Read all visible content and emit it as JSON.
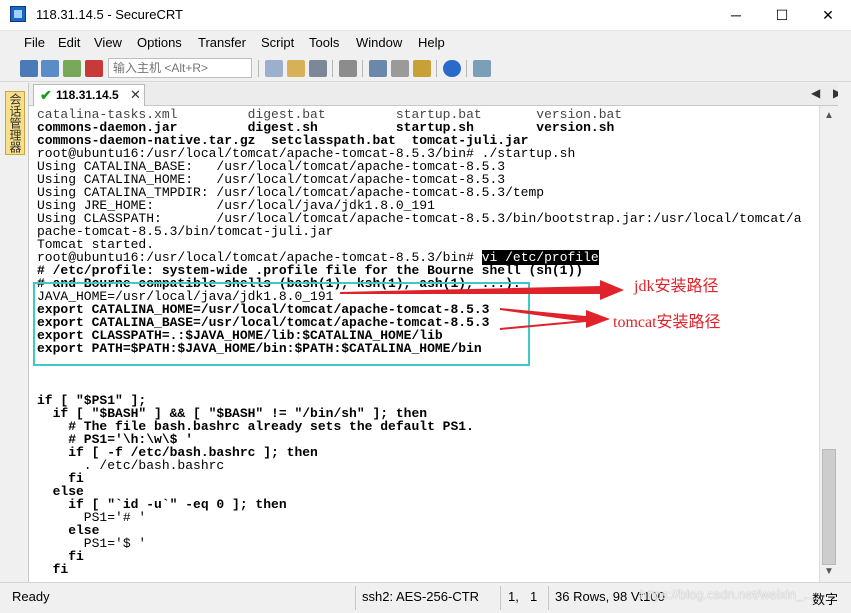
{
  "window": {
    "title": "118.31.14.5 - SecureCRT",
    "minimize": "─",
    "maximize": "☐",
    "close": "✕"
  },
  "menu": [
    "File",
    "Edit",
    "View",
    "Options",
    "Transfer",
    "Script",
    "Tools",
    "Window",
    "Help"
  ],
  "toolbar": {
    "host_placeholder": "输入主机 <Alt+R>"
  },
  "side_panel": {
    "label": "会话管理器"
  },
  "session_tab": {
    "label": "118.31.14.5",
    "close": "✕",
    "nav_left": "◀",
    "nav_right": "▶"
  },
  "terminal": {
    "lines": [
      "catalina-tasks.xml         digest.bat         startup.bat       version.bat",
      "commons-daemon.jar         digest.sh          startup.sh        version.sh",
      "commons-daemon-native.tar.gz  setclasspath.bat  tomcat-juli.jar",
      "root@ubuntu16:/usr/local/tomcat/apache-tomcat-8.5.3/bin# ./startup.sh",
      "Using CATALINA_BASE:   /usr/local/tomcat/apache-tomcat-8.5.3",
      "Using CATALINA_HOME:   /usr/local/tomcat/apache-tomcat-8.5.3",
      "Using CATALINA_TMPDIR: /usr/local/tomcat/apache-tomcat-8.5.3/temp",
      "Using JRE_HOME:        /usr/local/java/jdk1.8.0_191",
      "Using CLASSPATH:       /usr/local/tomcat/apache-tomcat-8.5.3/bin/bootstrap.jar:/usr/local/tomcat/a",
      "pache-tomcat-8.5.3/bin/tomcat-juli.jar",
      "Tomcat started.",
      "root@ubuntu16:/usr/local/tomcat/apache-tomcat-8.5.3/bin# ",
      "# /etc/profile: system-wide .profile file for the Bourne shell (sh(1))",
      "# and Bourne compatible shells (bash(1), ksh(1), ash(1), ...).",
      "JAVA_HOME=/usr/local/java/jdk1.8.0_191",
      "export CATALINA_HOME=/usr/local/tomcat/apache-tomcat-8.5.3",
      "export CATALINA_BASE=/usr/local/tomcat/apache-tomcat-8.5.3",
      "export CLASSPATH=.:$JAVA_HOME/lib:$CATALINA_HOME/lib",
      "export PATH=$PATH:$JAVA_HOME/bin:$PATH:$CATALINA_HOME/bin",
      "",
      "",
      "if [ \"$PS1\" ];",
      "  if [ \"$BASH\" ] && [ \"$BASH\" != \"/bin/sh\" ]; then",
      "    # The file bash.bashrc already sets the default PS1.",
      "    # PS1='\\h:\\w\\$ '",
      "    if [ -f /etc/bash.bashrc ]; then",
      "      . /etc/bash.bashrc",
      "    fi",
      "  else",
      "    if [ \"`id -u`\" -eq 0 ]; then",
      "      PS1='# '",
      "    else",
      "      PS1='$ '",
      "    fi",
      "  fi"
    ],
    "command_highlight": "vi /etc/profile"
  },
  "annotations": {
    "jdk": "jdk安装路径",
    "tomcat": "tomcat安装路径",
    "arrow_color": "#e0222a",
    "box_color": "#3ec8c8"
  },
  "status": {
    "ready": "Ready",
    "cipher": "ssh2: AES-256-CTR",
    "row": "1,",
    "col": "1",
    "size": "36 Rows, 98 Vt100",
    "num": "数字"
  },
  "watermark": "https://blog.csdn.net/weixin_..."
}
